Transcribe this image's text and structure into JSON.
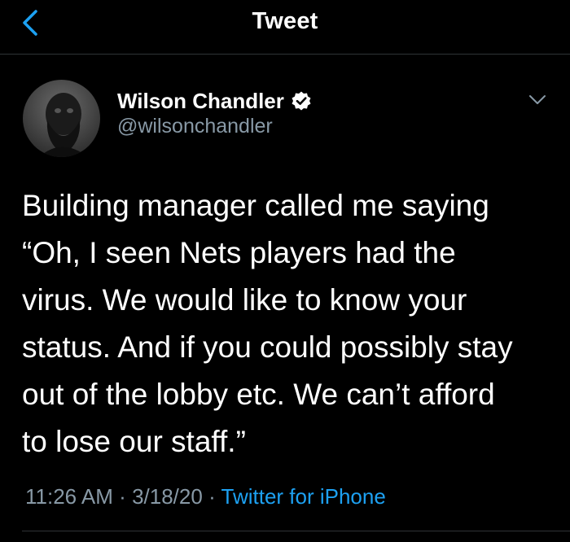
{
  "header": {
    "title": "Tweet",
    "back_icon": "chevron-left-icon"
  },
  "tweet": {
    "author": {
      "display_name": "Wilson Chandler",
      "handle": "@wilsonchandler",
      "verified": true
    },
    "text": "Building manager called me saying \n“Oh, I seen Nets players had the \nvirus. We would like to know your \nstatus. And if you could possibly stay \nout of the lobby etc. We can’t afford \nto lose our staff.”",
    "time": "11:26 AM",
    "date": "3/18/20",
    "separator": "·",
    "source": "Twitter for iPhone"
  },
  "colors": {
    "background": "#000000",
    "text": "#ffffff",
    "secondary": "#8899a6",
    "accent": "#1da1f2",
    "divider": "#2f3336"
  }
}
